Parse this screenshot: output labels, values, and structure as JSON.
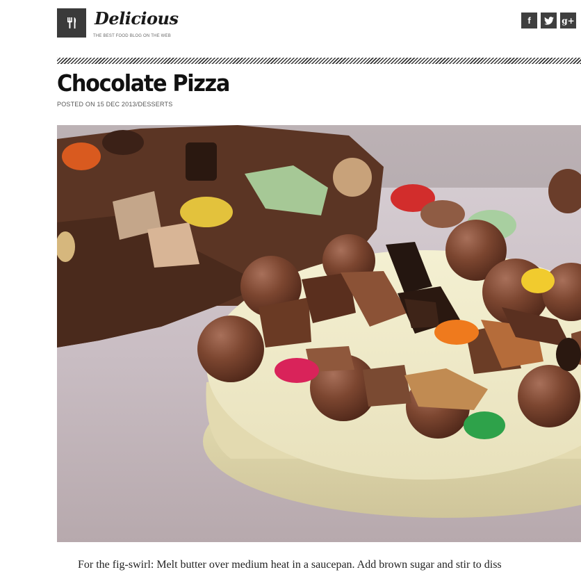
{
  "site": {
    "name": "Delicious",
    "tagline": "THE BEST FOOD BLOG ON THE WEB",
    "logo_icon": "fork-knife-icon"
  },
  "social": [
    {
      "icon": "facebook-icon",
      "glyph": "f"
    },
    {
      "icon": "twitter-icon",
      "glyph": "t"
    },
    {
      "icon": "google-plus-icon",
      "glyph": "g+"
    }
  ],
  "post": {
    "title": "Chocolate Pizza",
    "meta_prefix": "POSTED ON 15 DEC 2013",
    "meta_separator": "/",
    "category": "DESSERTS",
    "excerpt": "For the fig-swirl: Melt butter over medium heat in a saucepan. Add brown sugar and stir to diss"
  },
  "colors": {
    "logo_bg": "#3a3a3a",
    "social_bg": "#3f3f3f",
    "hatch": "#333333"
  }
}
